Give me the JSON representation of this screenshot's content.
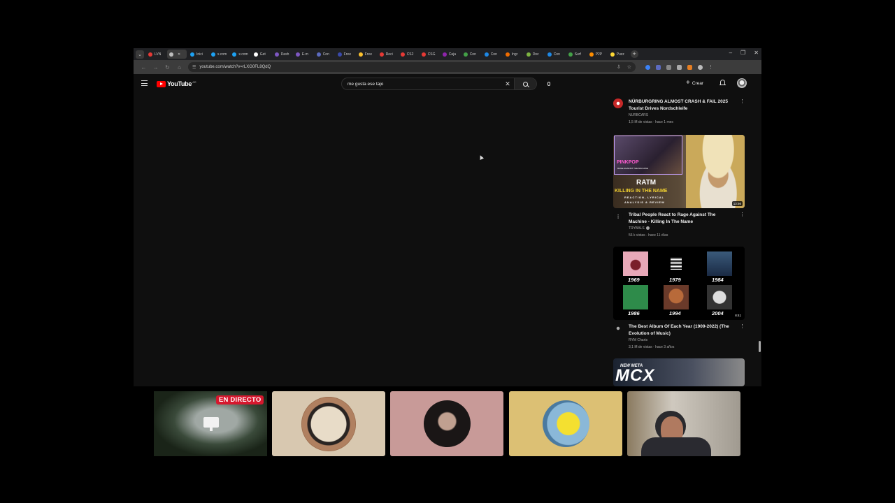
{
  "browser": {
    "tabs": [
      {
        "label": "LVN",
        "color": "#e53935"
      },
      {
        "label": "",
        "color": "#bdbdbd",
        "active": true
      },
      {
        "label": "Inici",
        "color": "#1da1f2"
      },
      {
        "label": "x.com",
        "color": "#1da1f2"
      },
      {
        "label": "x.com",
        "color": "#1da1f2"
      },
      {
        "label": "Get",
        "color": "#ffffff"
      },
      {
        "label": "Dash",
        "color": "#7e57c2"
      },
      {
        "label": "E-m",
        "color": "#7e57c2"
      },
      {
        "label": "Con",
        "color": "#5c6bc0"
      },
      {
        "label": "Free",
        "color": "#3949ab"
      },
      {
        "label": "Free",
        "color": "#fbc02d"
      },
      {
        "label": "Reci",
        "color": "#e53935"
      },
      {
        "label": "CS2",
        "color": "#e53935"
      },
      {
        "label": "CSG",
        "color": "#e53935"
      },
      {
        "label": "Caja",
        "color": "#8e24aa"
      },
      {
        "label": "Con",
        "color": "#43a047"
      },
      {
        "label": "Con",
        "color": "#1e88e5"
      },
      {
        "label": "Ingr",
        "color": "#ef6c00"
      },
      {
        "label": "Doc",
        "color": "#7cb342"
      },
      {
        "label": "Con",
        "color": "#1e88e5"
      },
      {
        "label": "Surf",
        "color": "#43a047"
      },
      {
        "label": "P2P",
        "color": "#fb8c00"
      },
      {
        "label": "Puzz",
        "color": "#fdd835"
      }
    ],
    "url": "youtube.com/watch?v=rLXG0FL8QdQ",
    "window_controls": [
      "–",
      "❐",
      "✕"
    ],
    "nav": [
      "←",
      "→",
      "↻",
      "⌂"
    ],
    "tail_icons": [
      "⇩",
      "☆"
    ]
  },
  "youtube": {
    "logo_text": "YouTube",
    "logo_country": "AR",
    "search": {
      "value": "me gusta ese tajo"
    },
    "create_label": "Crear",
    "recommendations": [
      {
        "title": "NÜRBURGRING ALMOST CRASH & FAIL 2025 Tourist Drives Nordschleife",
        "channel": "NURBCARS",
        "stats": "1,5 M de vistas · hace 1 mes"
      },
      {
        "title": "Tribal People React to Rage Against The Machine - Killing In The Name",
        "channel": "TRYBALS",
        "stats": "56 k vistas · hace 11 días",
        "duration": "13:56",
        "thumb_lines": [
          "RATM",
          "KILLING IN THE NAME",
          "REACTION, LYRICAL",
          "ANALYSIS & REVIEW"
        ],
        "thumb_logo": "PINKPOP",
        "thumb_sub": "RAGE AGAINST THE MACHINE"
      },
      {
        "title": "The Best Album Of Each Year (1909-2022) (The Evolution of Music)",
        "channel": "RYM Charts",
        "stats": "3,1 M de vistas · hace 3 años",
        "duration": "8:41",
        "years": [
          "1969",
          "1979",
          "1984",
          "1986",
          "1994",
          "2004"
        ]
      },
      {
        "thumb_lines": [
          "NEW META",
          "MCX"
        ]
      }
    ]
  },
  "stream": {
    "live_badge": "EN DIRECTO"
  }
}
